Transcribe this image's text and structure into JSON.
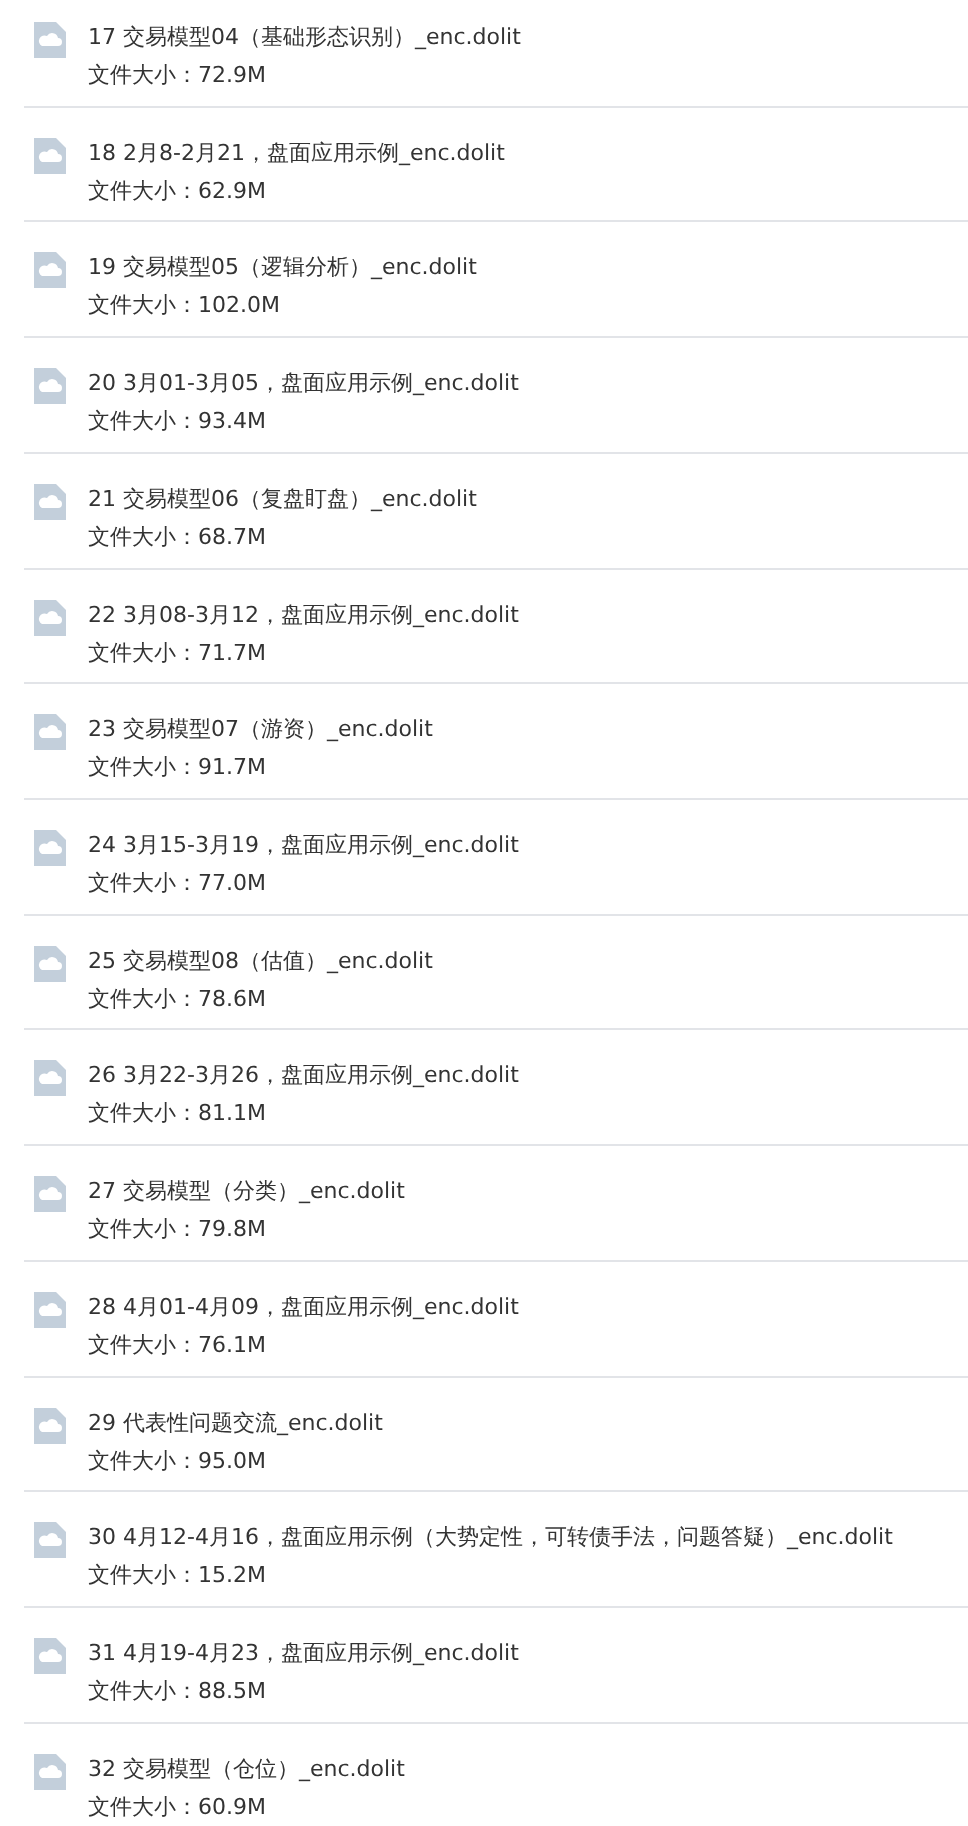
{
  "files": [
    {
      "name": "17 交易模型04（基础形态识别）_enc.dolit",
      "size": "文件大小：72.9M"
    },
    {
      "name": "18 2月8-2月21，盘面应用示例_enc.dolit",
      "size": "文件大小：62.9M"
    },
    {
      "name": "19 交易模型05（逻辑分析）_enc.dolit",
      "size": "文件大小：102.0M"
    },
    {
      "name": "20 3月01-3月05，盘面应用示例_enc.dolit",
      "size": "文件大小：93.4M"
    },
    {
      "name": "21 交易模型06（复盘盯盘）_enc.dolit",
      "size": "文件大小：68.7M"
    },
    {
      "name": "22 3月08-3月12，盘面应用示例_enc.dolit",
      "size": "文件大小：71.7M"
    },
    {
      "name": "23 交易模型07（游资）_enc.dolit",
      "size": "文件大小：91.7M"
    },
    {
      "name": "24 3月15-3月19，盘面应用示例_enc.dolit",
      "size": "文件大小：77.0M"
    },
    {
      "name": "25 交易模型08（估值）_enc.dolit",
      "size": "文件大小：78.6M"
    },
    {
      "name": "26 3月22-3月26，盘面应用示例_enc.dolit",
      "size": "文件大小：81.1M"
    },
    {
      "name": "27 交易模型（分类）_enc.dolit",
      "size": "文件大小：79.8M"
    },
    {
      "name": "28 4月01-4月09，盘面应用示例_enc.dolit",
      "size": "文件大小：76.1M"
    },
    {
      "name": "29 代表性问题交流_enc.dolit",
      "size": "文件大小：95.0M"
    },
    {
      "name": "30 4月12-4月16，盘面应用示例（大势定性，可转债手法，问题答疑）_enc.dolit",
      "size": "文件大小：15.2M"
    },
    {
      "name": "31 4月19-4月23，盘面应用示例_enc.dolit",
      "size": "文件大小：88.5M"
    },
    {
      "name": "32 交易模型（仓位）_enc.dolit",
      "size": "文件大小：60.9M"
    }
  ]
}
